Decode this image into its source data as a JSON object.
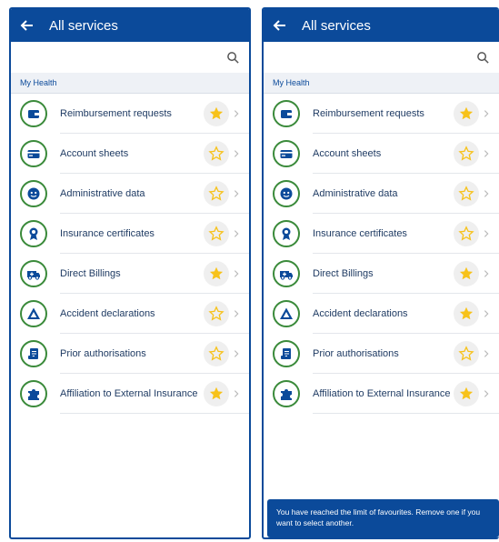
{
  "screens": [
    {
      "header": {
        "title": "All services"
      },
      "section": {
        "title": "My Health"
      },
      "items": [
        {
          "label": "Reimbursement requests",
          "icon": "wallet-icon",
          "favorite": true
        },
        {
          "label": "Account sheets",
          "icon": "card-icon",
          "favorite": false
        },
        {
          "label": "Administrative data",
          "icon": "face-icon",
          "favorite": false
        },
        {
          "label": "Insurance certificates",
          "icon": "award-icon",
          "favorite": false
        },
        {
          "label": "Direct Billings",
          "icon": "ambulance-icon",
          "favorite": true
        },
        {
          "label": "Accident declarations",
          "icon": "warning-triangle-icon",
          "favorite": false
        },
        {
          "label": "Prior authorisations",
          "icon": "document-icon",
          "favorite": false
        },
        {
          "label": "Affiliation to External Insurance",
          "icon": "puzzle-icon",
          "favorite": true
        }
      ]
    },
    {
      "header": {
        "title": "All services"
      },
      "section": {
        "title": "My Health"
      },
      "items": [
        {
          "label": "Reimbursement requests",
          "icon": "wallet-icon",
          "favorite": true
        },
        {
          "label": "Account sheets",
          "icon": "card-icon",
          "favorite": false
        },
        {
          "label": "Administrative data",
          "icon": "face-icon",
          "favorite": false
        },
        {
          "label": "Insurance certificates",
          "icon": "award-icon",
          "favorite": false
        },
        {
          "label": "Direct Billings",
          "icon": "ambulance-icon",
          "favorite": true
        },
        {
          "label": "Accident declarations",
          "icon": "warning-triangle-icon",
          "favorite": true
        },
        {
          "label": "Prior authorisations",
          "icon": "document-icon",
          "favorite": false
        },
        {
          "label": "Affiliation to External Insurance",
          "icon": "puzzle-icon",
          "favorite": true
        }
      ],
      "toast": {
        "text": "You have reached the limit of favourites. Remove one if you want to select another."
      }
    }
  ],
  "colors": {
    "primary": "#0b4a9a",
    "icon_ring": "#3a8a3a",
    "star_filled": "#f7c21a",
    "star_outline": "#f7c21a",
    "section_bg": "#eef1f6"
  }
}
